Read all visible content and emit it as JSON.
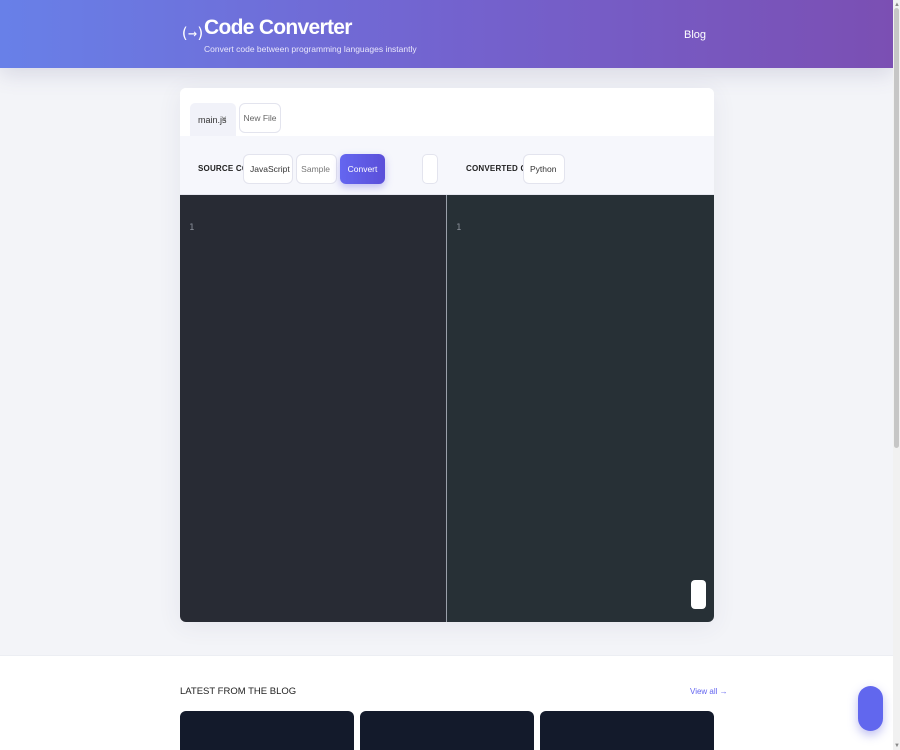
{
  "header": {
    "logo_glyph": "(→)",
    "title": "Code Converter",
    "subtitle": "Convert code between programming languages instantly",
    "nav_blog": "Blog"
  },
  "tabs": {
    "active": {
      "label": "main.js",
      "close": "×"
    },
    "new_file": "New File"
  },
  "toolbar": {
    "source_label": "SOURCE CODE",
    "source_language": "JavaScript",
    "sample_label": "Sample",
    "convert_label": "Convert",
    "converted_label": "CONVERTED CODE",
    "target_language": "Python"
  },
  "editors": {
    "source_line": "1",
    "target_line": "1"
  },
  "blog": {
    "heading": "LATEST FROM THE BLOG",
    "view_all": "View all →"
  },
  "scrollbar": {
    "up": "▲",
    "down": "▼"
  },
  "colors": {
    "header_gradient_start": "#6880e8",
    "header_gradient_end": "#7b4fb3",
    "accent": "#6466f0",
    "editor_source_bg": "#282b34",
    "editor_target_bg": "#273036",
    "blog_card_bg": "#131a2b"
  }
}
